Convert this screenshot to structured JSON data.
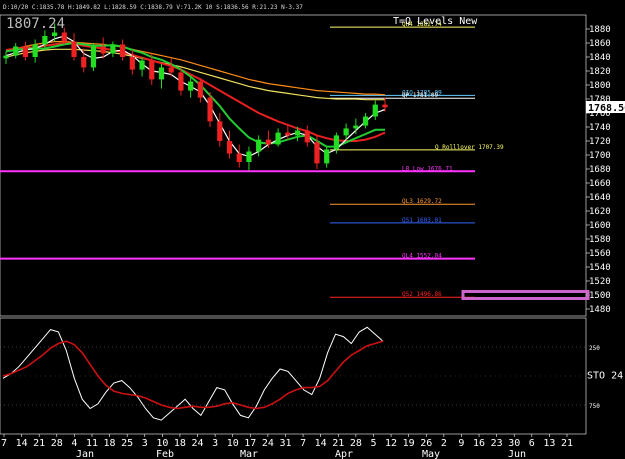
{
  "header": {
    "symbol_price": "1807.24",
    "ohlc_text": "D:10/20 C:1835.78 H:1849.82 L:1828.59 C:1838.79 V:71.2K 10 S:1836.56 R:21.23 N-3.37"
  },
  "chart_data": [
    {
      "type": "candlestick",
      "title": "",
      "legend": [
        "T=Q Levels New"
      ],
      "last_price": "1768.56",
      "ylim": [
        1470,
        1900
      ],
      "yticks": [
        1480,
        1500,
        1520,
        1540,
        1560,
        1580,
        1600,
        1620,
        1640,
        1660,
        1680,
        1700,
        1720,
        1740,
        1760,
        1780,
        1800,
        1820,
        1840,
        1860,
        1880
      ],
      "candles": [
        {
          "t": 0,
          "o": 1838,
          "h": 1848,
          "l": 1830,
          "c": 1842
        },
        {
          "t": 1,
          "o": 1842,
          "h": 1860,
          "l": 1838,
          "c": 1855
        },
        {
          "t": 2,
          "o": 1855,
          "h": 1862,
          "l": 1835,
          "c": 1840
        },
        {
          "t": 3,
          "o": 1840,
          "h": 1865,
          "l": 1832,
          "c": 1858
        },
        {
          "t": 4,
          "o": 1858,
          "h": 1878,
          "l": 1850,
          "c": 1870
        },
        {
          "t": 5,
          "o": 1870,
          "h": 1888,
          "l": 1862,
          "c": 1875
        },
        {
          "t": 6,
          "o": 1875,
          "h": 1882,
          "l": 1858,
          "c": 1862
        },
        {
          "t": 7,
          "o": 1862,
          "h": 1874,
          "l": 1835,
          "c": 1840
        },
        {
          "t": 8,
          "o": 1840,
          "h": 1852,
          "l": 1818,
          "c": 1825
        },
        {
          "t": 9,
          "o": 1825,
          "h": 1860,
          "l": 1820,
          "c": 1855
        },
        {
          "t": 10,
          "o": 1855,
          "h": 1868,
          "l": 1838,
          "c": 1845
        },
        {
          "t": 11,
          "o": 1845,
          "h": 1862,
          "l": 1840,
          "c": 1858
        },
        {
          "t": 12,
          "o": 1858,
          "h": 1865,
          "l": 1835,
          "c": 1840
        },
        {
          "t": 13,
          "o": 1840,
          "h": 1850,
          "l": 1815,
          "c": 1822
        },
        {
          "t": 14,
          "o": 1822,
          "h": 1840,
          "l": 1812,
          "c": 1835
        },
        {
          "t": 15,
          "o": 1835,
          "h": 1845,
          "l": 1800,
          "c": 1808
        },
        {
          "t": 16,
          "o": 1808,
          "h": 1830,
          "l": 1795,
          "c": 1825
        },
        {
          "t": 17,
          "o": 1825,
          "h": 1838,
          "l": 1812,
          "c": 1818
        },
        {
          "t": 18,
          "o": 1818,
          "h": 1825,
          "l": 1785,
          "c": 1792
        },
        {
          "t": 19,
          "o": 1792,
          "h": 1812,
          "l": 1782,
          "c": 1805
        },
        {
          "t": 20,
          "o": 1805,
          "h": 1810,
          "l": 1775,
          "c": 1782
        },
        {
          "t": 21,
          "o": 1782,
          "h": 1790,
          "l": 1740,
          "c": 1748
        },
        {
          "t": 22,
          "o": 1748,
          "h": 1760,
          "l": 1712,
          "c": 1720
        },
        {
          "t": 23,
          "o": 1720,
          "h": 1735,
          "l": 1695,
          "c": 1702
        },
        {
          "t": 24,
          "o": 1702,
          "h": 1715,
          "l": 1682,
          "c": 1690
        },
        {
          "t": 25,
          "o": 1690,
          "h": 1712,
          "l": 1678,
          "c": 1705
        },
        {
          "t": 26,
          "o": 1705,
          "h": 1728,
          "l": 1698,
          "c": 1722
        },
        {
          "t": 27,
          "o": 1722,
          "h": 1735,
          "l": 1710,
          "c": 1715
        },
        {
          "t": 28,
          "o": 1715,
          "h": 1738,
          "l": 1712,
          "c": 1732
        },
        {
          "t": 29,
          "o": 1732,
          "h": 1742,
          "l": 1722,
          "c": 1728
        },
        {
          "t": 30,
          "o": 1728,
          "h": 1740,
          "l": 1720,
          "c": 1735
        },
        {
          "t": 31,
          "o": 1735,
          "h": 1742,
          "l": 1712,
          "c": 1718
        },
        {
          "t": 32,
          "o": 1718,
          "h": 1728,
          "l": 1680,
          "c": 1688
        },
        {
          "t": 33,
          "o": 1688,
          "h": 1712,
          "l": 1682,
          "c": 1708
        },
        {
          "t": 34,
          "o": 1708,
          "h": 1732,
          "l": 1702,
          "c": 1728
        },
        {
          "t": 35,
          "o": 1728,
          "h": 1745,
          "l": 1722,
          "c": 1738
        },
        {
          "t": 36,
          "o": 1738,
          "h": 1752,
          "l": 1730,
          "c": 1742
        },
        {
          "t": 37,
          "o": 1742,
          "h": 1760,
          "l": 1738,
          "c": 1755
        },
        {
          "t": 38,
          "o": 1755,
          "h": 1778,
          "l": 1750,
          "c": 1772
        },
        {
          "t": 39,
          "o": 1772,
          "h": 1782,
          "l": 1762,
          "c": 1768
        }
      ],
      "moving_averages": [
        {
          "color": "#ff8c1a",
          "values": [
            1848,
            1852,
            1855,
            1858,
            1860,
            1862,
            1862,
            1861,
            1860,
            1859,
            1858,
            1856,
            1854,
            1851,
            1848,
            1845,
            1842,
            1839,
            1836,
            1832,
            1828,
            1824,
            1820,
            1816,
            1812,
            1808,
            1805,
            1802,
            1800,
            1798,
            1796,
            1794,
            1792,
            1791,
            1790,
            1789,
            1788,
            1787,
            1787,
            1786
          ]
        },
        {
          "color": "#f0e060",
          "values": [
            1840,
            1843,
            1846,
            1848,
            1850,
            1851,
            1851,
            1851,
            1850,
            1849,
            1848,
            1846,
            1844,
            1841,
            1838,
            1835,
            1832,
            1829,
            1826,
            1822,
            1818,
            1814,
            1810,
            1806,
            1802,
            1798,
            1795,
            1792,
            1790,
            1788,
            1786,
            1784,
            1782,
            1781,
            1780,
            1780,
            1780,
            1779,
            1779,
            1779
          ]
        },
        {
          "color": "#e82020",
          "values": [
            1850,
            1852,
            1853,
            1854,
            1856,
            1858,
            1860,
            1859,
            1856,
            1854,
            1852,
            1850,
            1847,
            1843,
            1839,
            1835,
            1831,
            1827,
            1822,
            1815,
            1808,
            1800,
            1792,
            1784,
            1776,
            1768,
            1760,
            1754,
            1748,
            1743,
            1738,
            1734,
            1728,
            1724,
            1721,
            1720,
            1720,
            1722,
            1726,
            1732
          ]
        },
        {
          "color": "#22cc33",
          "values": [
            1848,
            1850,
            1852,
            1852,
            1852,
            1855,
            1858,
            1860,
            1858,
            1856,
            1856,
            1857,
            1855,
            1850,
            1846,
            1840,
            1836,
            1830,
            1822,
            1812,
            1800,
            1785,
            1770,
            1752,
            1738,
            1725,
            1718,
            1716,
            1718,
            1722,
            1726,
            1728,
            1720,
            1712,
            1712,
            1718,
            1724,
            1730,
            1736,
            1736
          ]
        },
        {
          "color": "#ffffff",
          "values": [
            1842,
            1846,
            1850,
            1852,
            1858,
            1866,
            1870,
            1862,
            1845,
            1838,
            1840,
            1848,
            1850,
            1842,
            1830,
            1820,
            1818,
            1815,
            1805,
            1798,
            1790,
            1770,
            1745,
            1720,
            1702,
            1698,
            1705,
            1715,
            1722,
            1728,
            1732,
            1728,
            1712,
            1702,
            1708,
            1722,
            1735,
            1748,
            1760,
            1765
          ]
        }
      ],
      "levels": [
        {
          "label": "QH4 1882.74",
          "value": 1882.74,
          "color": "#ffff66"
        },
        {
          "label": "QIO 1785.09",
          "value": 1785.09,
          "color": "#66ccff"
        },
        {
          "label": "QP 1781.09",
          "value": 1781.09,
          "color": "#ffffff"
        },
        {
          "label": "Q Rolllover 1707.39",
          "value": 1707.39,
          "color": "#ffff66"
        },
        {
          "label": "L8 Low 1676.71",
          "value": 1676.71,
          "color": "#ff33ff"
        },
        {
          "label": "QL3 1629.72",
          "value": 1629.72,
          "color": "#ff9933"
        },
        {
          "label": "QS1 1603.01",
          "value": 1603.01,
          "color": "#3366ff"
        },
        {
          "label": "QL4 1552.04",
          "value": 1552.04,
          "color": "#ff33ff"
        },
        {
          "label": "QS2 1496.86",
          "value": 1496.86,
          "color": "#ff2222"
        }
      ],
      "x_tick_labels": [
        "7",
        "14",
        "21",
        "28",
        "4",
        "11",
        "18",
        "25",
        "3",
        "10",
        "18",
        "24",
        "3",
        "10",
        "17",
        "24",
        "31",
        "7",
        "14",
        "21",
        "28",
        "5",
        "12",
        "19",
        "26",
        "2",
        "9",
        "16",
        "23",
        "30",
        "6",
        "13",
        "21"
      ],
      "month_labels": [
        "Jan",
        "Feb",
        "Mar",
        "Apr",
        "May",
        "Jun"
      ]
    },
    {
      "type": "line",
      "title": "",
      "label": "STO 24.",
      "ylim": [
        0,
        100
      ],
      "yticks": [
        250,
        750
      ],
      "series": [
        {
          "color": "#ffffff",
          "values": [
            48,
            52,
            58,
            66,
            74,
            82,
            90,
            88,
            72,
            48,
            30,
            22,
            26,
            36,
            44,
            46,
            40,
            32,
            22,
            14,
            12,
            18,
            24,
            30,
            22,
            16,
            28,
            40,
            38,
            26,
            16,
            14,
            24,
            38,
            48,
            56,
            54,
            46,
            38,
            34,
            48,
            70,
            86,
            84,
            78,
            88,
            92,
            86,
            80
          ]
        },
        {
          "color": "#cc1111",
          "values": [
            50,
            52,
            55,
            58,
            63,
            68,
            74,
            78,
            80,
            77,
            70,
            60,
            50,
            42,
            37,
            35,
            34,
            33,
            31,
            28,
            25,
            23,
            22,
            23,
            24,
            23,
            23,
            24,
            26,
            27,
            25,
            23,
            22,
            23,
            26,
            30,
            35,
            38,
            40,
            40,
            41,
            46,
            54,
            62,
            68,
            72,
            76,
            78,
            80
          ]
        }
      ]
    }
  ]
}
